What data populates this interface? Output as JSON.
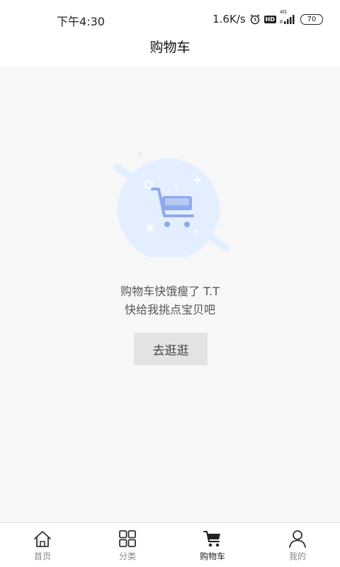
{
  "status_bar": {
    "time": "下午4:30",
    "network_speed": "1.6K/s",
    "icons": [
      "alarm-icon",
      "hd-icon",
      "4g-signal-icon"
    ],
    "hd_label": "HD",
    "network_type": "4G",
    "battery": "70"
  },
  "header": {
    "title": "购物车"
  },
  "empty_state": {
    "line1": "购物车快饿瘦了 T.T",
    "line2": "快给我挑点宝贝吧",
    "button_label": "去逛逛",
    "illustration": "empty-cart-icon"
  },
  "tabs": [
    {
      "label": "首页",
      "icon": "home-icon",
      "active": false
    },
    {
      "label": "分类",
      "icon": "category-grid-icon",
      "active": false
    },
    {
      "label": "购物车",
      "icon": "cart-icon",
      "active": true
    },
    {
      "label": "我的",
      "icon": "user-icon",
      "active": false
    }
  ],
  "colors": {
    "background": "#f7f7f7",
    "illustration_blue": "#e3efff",
    "cart_blue": "#8fa9ee",
    "active_tab": "#222222",
    "inactive_tab": "#888888"
  }
}
